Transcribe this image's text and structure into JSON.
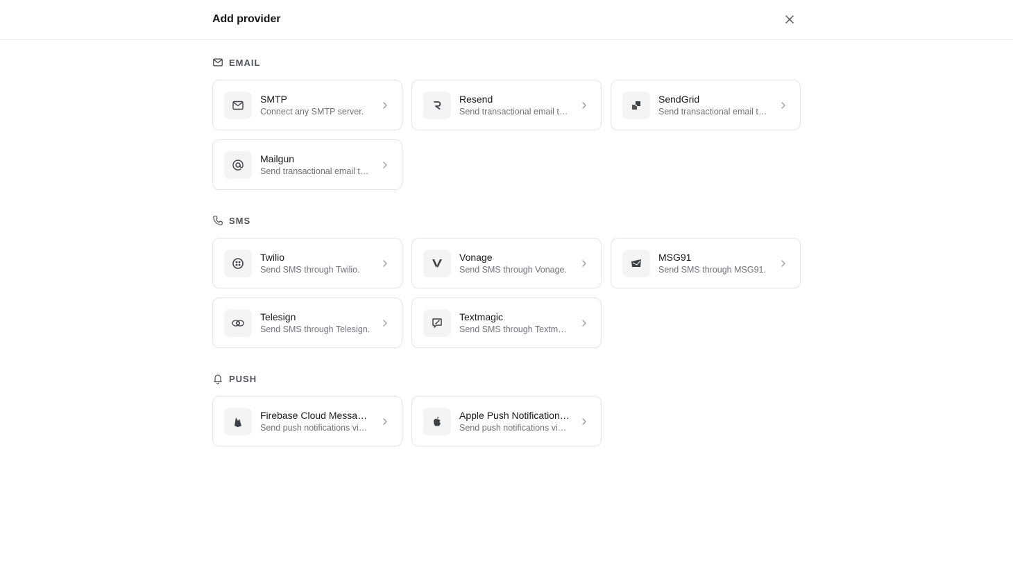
{
  "header": {
    "title": "Add provider",
    "close_icon": "close-icon"
  },
  "sections": [
    {
      "title": "EMAIL",
      "icon": "mail-icon",
      "providers": [
        {
          "name": "SMTP",
          "description": "Connect any SMTP server.",
          "icon": "mail-icon"
        },
        {
          "name": "Resend",
          "description": "Send transactional email through Resend.",
          "icon": "resend-icon"
        },
        {
          "name": "SendGrid",
          "description": "Send transactional email through SendGrid.",
          "icon": "sendgrid-icon"
        },
        {
          "name": "Mailgun",
          "description": "Send transactional email through Mailgun.",
          "icon": "at-sign-icon"
        }
      ]
    },
    {
      "title": "SMS",
      "icon": "phone-icon",
      "providers": [
        {
          "name": "Twilio",
          "description": "Send SMS through Twilio.",
          "icon": "twilio-icon"
        },
        {
          "name": "Vonage",
          "description": "Send SMS through Vonage.",
          "icon": "vonage-icon"
        },
        {
          "name": "MSG91",
          "description": "Send SMS through MSG91.",
          "icon": "msg91-icon"
        },
        {
          "name": "Telesign",
          "description": "Send SMS through Telesign.",
          "icon": "telesign-icon"
        },
        {
          "name": "Textmagic",
          "description": "Send SMS through Textmagic.",
          "icon": "textmagic-icon"
        }
      ]
    },
    {
      "title": "PUSH",
      "icon": "bell-icon",
      "providers": [
        {
          "name": "Firebase Cloud Messaging",
          "description": "Send push notifications via Firebase Cloud Messaging.",
          "icon": "firebase-icon"
        },
        {
          "name": "Apple Push Notification Service",
          "description": "Send push notifications via Apple Push Notification Service.",
          "icon": "apple-icon"
        }
      ]
    }
  ]
}
